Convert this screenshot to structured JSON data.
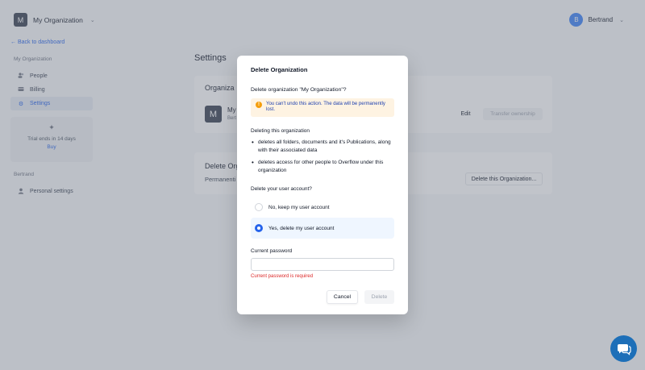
{
  "topbar": {
    "org_initial": "M",
    "org_name": "My Organization",
    "user_initial": "B",
    "user_name": "Bertrand"
  },
  "back_link": "← Back to dashboard",
  "sidebar": {
    "section_org": "My Organization",
    "items": [
      {
        "label": "People",
        "icon": "people-icon"
      },
      {
        "label": "Billing",
        "icon": "billing-icon"
      },
      {
        "label": "Settings",
        "icon": "gear-icon",
        "active": true
      }
    ],
    "trial": {
      "text": "Trial ends in 14 days",
      "buy": "Buy"
    },
    "section_user": "Bertrand",
    "user_items": [
      {
        "label": "Personal settings",
        "icon": "user-icon"
      }
    ]
  },
  "main": {
    "page_title": "Settings",
    "org_card": {
      "title": "Organiza",
      "avatar_initial": "M",
      "name": "My",
      "sub": "Bert",
      "edit_label": "Edit",
      "transfer_label": "Transfer ownership"
    },
    "delete_card": {
      "title": "Delete Org",
      "text": "Permanenti",
      "button_label": "Delete this Organization..."
    }
  },
  "modal": {
    "title": "Delete Organization",
    "question": "Delete organization \"My Organization\"?",
    "warning": "You can't undo this action. The data will be permanently lost.",
    "deleting_heading": "Deleting this organization",
    "bullets": [
      "deletes all folders, documents and it's Publications, along with their associated data",
      "deletes access for other people to Overflow under this organization"
    ],
    "account_question": "Delete your user account?",
    "options": [
      {
        "label": "No, keep my user account",
        "selected": false
      },
      {
        "label": "Yes, delete my user account",
        "selected": true
      }
    ],
    "password_label": "Current password",
    "password_value": "",
    "error": "Current password is required",
    "cancel_label": "Cancel",
    "delete_label": "Delete"
  },
  "colors": {
    "accent": "#2563eb",
    "warning_bg": "#fef3e2",
    "warning_icon": "#f59e0b",
    "error": "#dc2626",
    "chat_launcher": "#1d6fb8"
  }
}
